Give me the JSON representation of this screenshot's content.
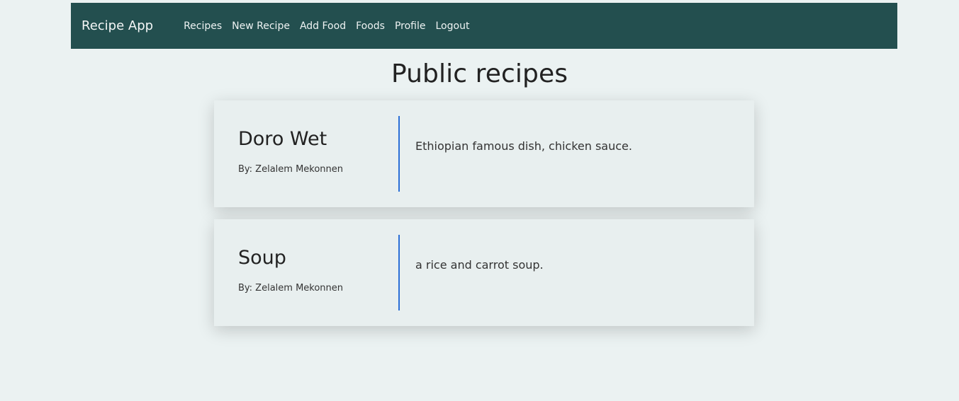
{
  "navbar": {
    "brand": "Recipe App",
    "links": [
      "Recipes",
      "New Recipe",
      "Add Food",
      "Foods",
      "Profile",
      "Logout"
    ]
  },
  "page": {
    "title": "Public recipes"
  },
  "recipes": [
    {
      "name": "Doro Wet",
      "author": "By: Zelalem Mekonnen",
      "description": "Ethiopian famous dish, chicken sauce."
    },
    {
      "name": "Soup",
      "author": "By: Zelalem Mekonnen",
      "description": "a rice and carrot soup."
    }
  ],
  "colors": {
    "navbar_bg": "#234f4f",
    "page_bg": "#ebf2f2",
    "divider": "#2b6fd6"
  }
}
